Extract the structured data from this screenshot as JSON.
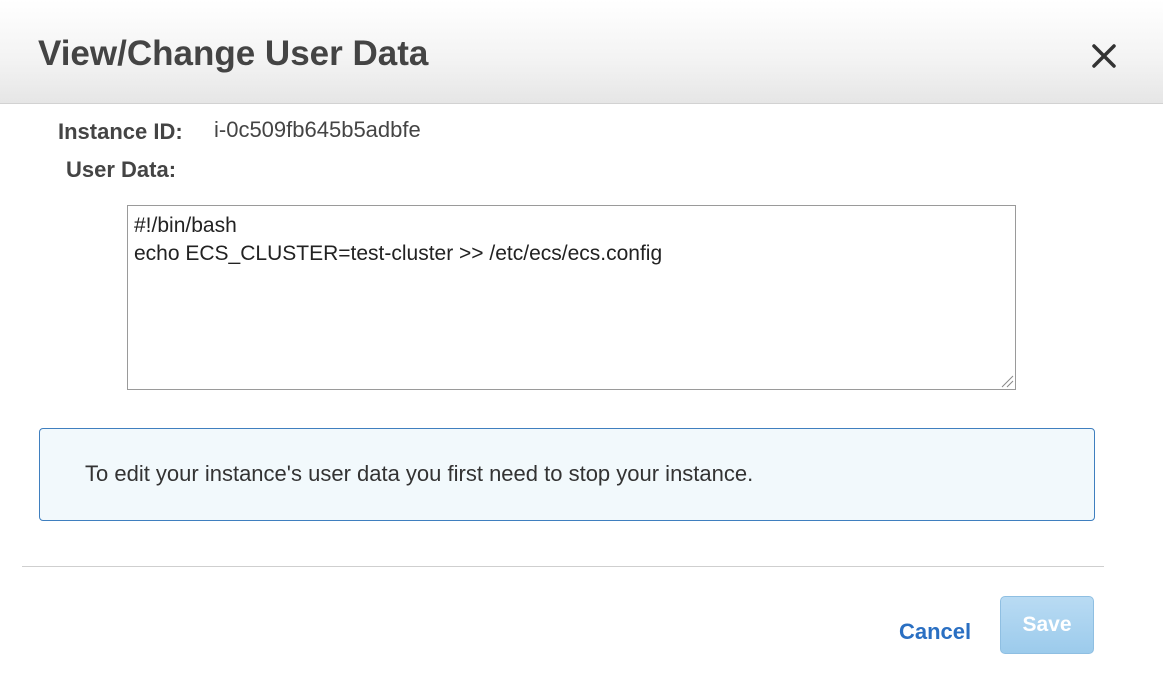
{
  "dialog": {
    "title": "View/Change User Data",
    "close_icon": "close-icon"
  },
  "fields": {
    "instance_id_label": "Instance ID:",
    "instance_id_value": "i-0c509fb645b5adbfe",
    "user_data_label": "User Data:",
    "user_data_value": "#!/bin/bash\necho ECS_CLUSTER=test-cluster >> /etc/ecs/ecs.config"
  },
  "info": {
    "message": "To edit your instance's user data you first need to stop your instance."
  },
  "footer": {
    "cancel_label": "Cancel",
    "save_label": "Save",
    "save_disabled": true
  },
  "colors": {
    "link": "#2a6fc2",
    "info_border": "#3f7fbf",
    "info_background": "#f2f9fc",
    "save_disabled_background": "#a9d2ef"
  }
}
